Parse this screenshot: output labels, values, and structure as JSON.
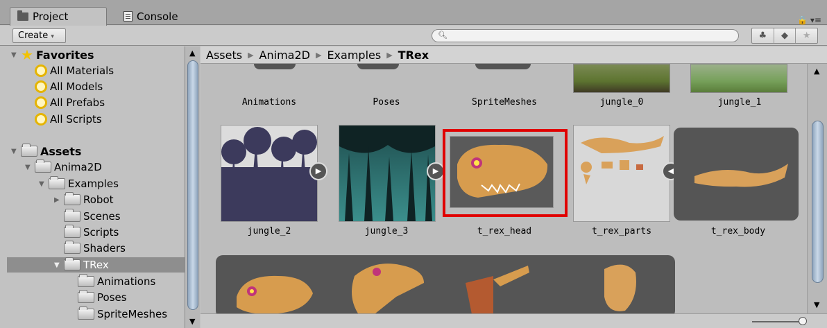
{
  "tabs": [
    {
      "label": "Project",
      "icon": "folder-icon"
    },
    {
      "label": "Console",
      "icon": "console-icon"
    }
  ],
  "toolbar": {
    "create_label": "Create",
    "search_placeholder": "",
    "buttons": [
      "label-filter-icon",
      "tag-icon",
      "star-icon"
    ]
  },
  "sidebar": {
    "favorites_label": "Favorites",
    "favorites": [
      "All Materials",
      "All Models",
      "All Prefabs",
      "All Scripts"
    ],
    "assets_label": "Assets",
    "tree": [
      {
        "label": "Anima2D",
        "depth": 1
      },
      {
        "label": "Examples",
        "depth": 2
      },
      {
        "label": "Robot",
        "depth": 3
      },
      {
        "label": "Scenes",
        "depth": 3
      },
      {
        "label": "Scripts",
        "depth": 3
      },
      {
        "label": "Shaders",
        "depth": 3
      },
      {
        "label": "TRex",
        "depth": 3
      },
      {
        "label": "Animations",
        "depth": 4
      },
      {
        "label": "Poses",
        "depth": 4
      },
      {
        "label": "SpriteMeshes",
        "depth": 4
      }
    ]
  },
  "breadcrumb": [
    "Assets",
    "Anima2D",
    "Examples",
    "TRex"
  ],
  "grid": {
    "row1": [
      "Animations",
      "Poses",
      "SpriteMeshes",
      "jungle_0",
      "jungle_1"
    ],
    "row2": [
      "jungle_2",
      "jungle_3",
      "t_rex_head",
      "t_rex_parts",
      "t_rex_body"
    ]
  },
  "colors": {
    "selection": "#e00000",
    "panel": "#c2c2c2",
    "selected_row": "#8e8e8e"
  }
}
